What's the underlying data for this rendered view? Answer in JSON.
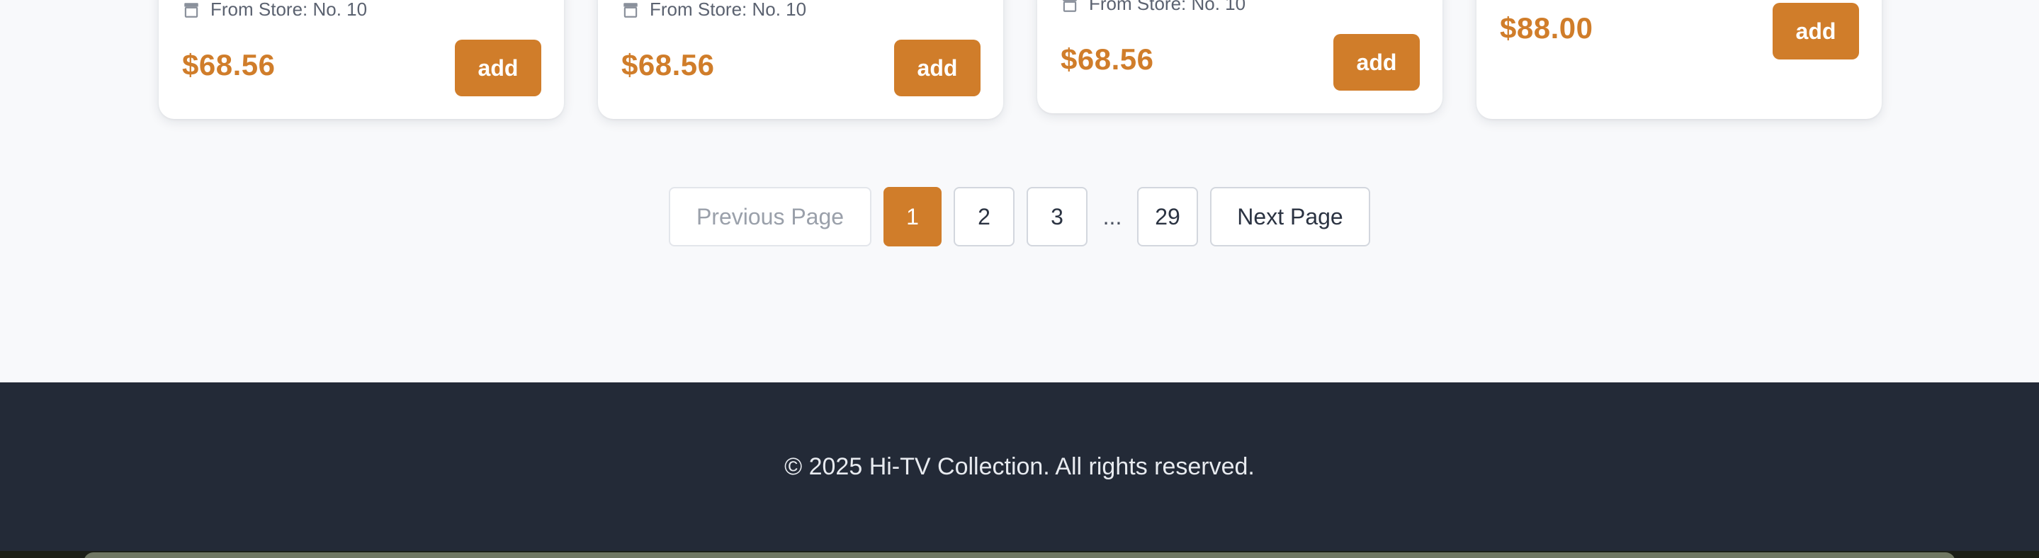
{
  "products": [
    {
      "store": "From Store: No. 10",
      "price": "$68.56",
      "add_label": "add"
    },
    {
      "store": "From Store: No. 10",
      "price": "$68.56",
      "add_label": "add"
    },
    {
      "store": "From Store: No. 10",
      "price": "$68.56",
      "add_label": "add"
    },
    {
      "store": "",
      "price": "$88.00",
      "add_label": "add"
    }
  ],
  "pagination": {
    "previous_label": "Previous Page",
    "pages": [
      "1",
      "2",
      "3"
    ],
    "ellipsis": "...",
    "last_page": "29",
    "current_page": "1",
    "next_label": "Next Page"
  },
  "footer": {
    "copyright": "© 2025 Hi-TV Collection. All rights reserved."
  },
  "colors": {
    "accent": "#d07d2a",
    "footer_bg": "#232a37",
    "page_bg": "#f8f9fb"
  }
}
